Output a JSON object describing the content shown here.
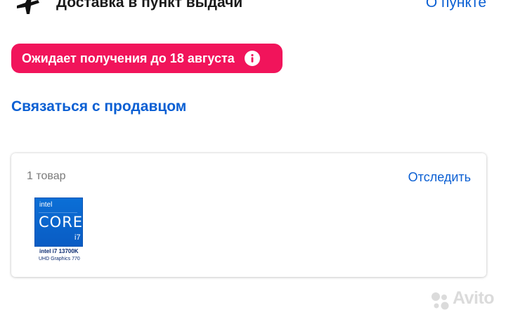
{
  "header": {
    "title": "Доставка в пункт выдачи",
    "about_link": "О пункте",
    "icon": "airplane-icon"
  },
  "status": {
    "text": "Ожидает получения до 18 августа",
    "color": "#f1145b",
    "icon": "info-icon"
  },
  "contact": {
    "label": "Связаться с продавцом"
  },
  "order": {
    "count_label": "1 товар",
    "track_label": "Отследить",
    "item": {
      "brand": "intel",
      "badge_title": "CORE",
      "badge_gen": "i7",
      "caption_line1": "intel i7 13700K",
      "caption_line2": "UHD Graphics 770"
    }
  },
  "watermark": "Avito",
  "colors": {
    "accent": "#0a5fd3",
    "alert": "#f1145b"
  }
}
